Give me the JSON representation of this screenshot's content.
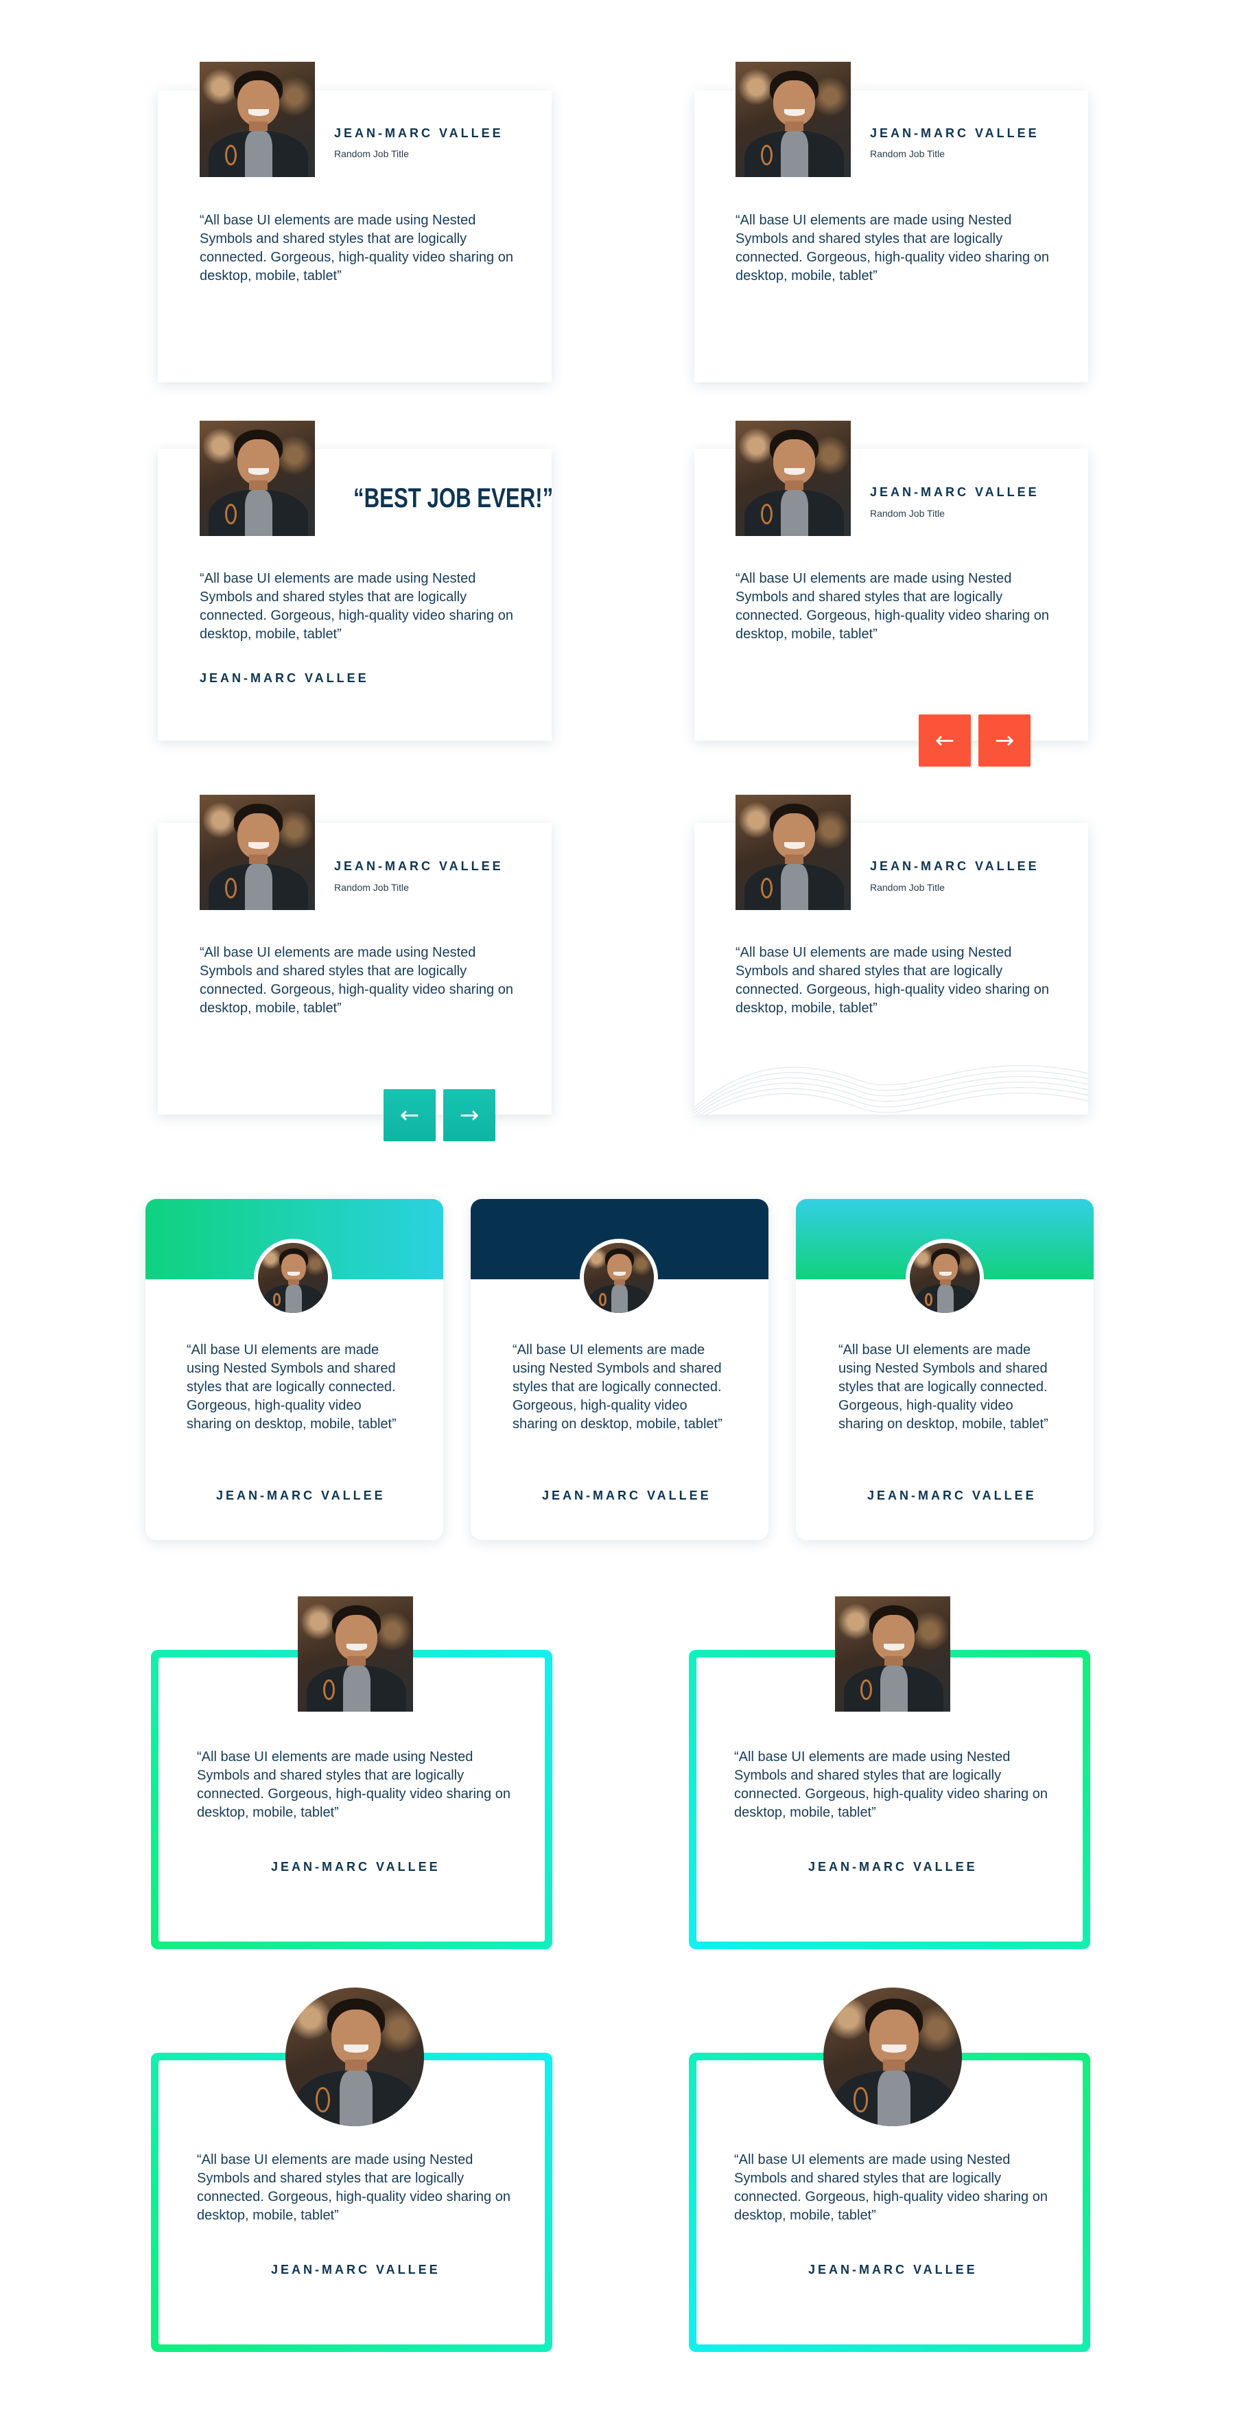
{
  "person": {
    "name": "JEAN-MARC VALLEE",
    "job_title": "Random Job Title",
    "quote": "“All base UI elements are made using Nested Symbols and shared styles that are logically connected. Gorgeous, high-quality video sharing on desktop, mobile, tablet”"
  },
  "headline": "“BEST JOB EVER!”",
  "arrows": {
    "prev": "←",
    "next": "→"
  },
  "colors": {
    "navy": "#0e3450",
    "red_arrow": "#fb5438",
    "teal_arrow": "#17c3b2",
    "green": "#12e07a",
    "cyan": "#12f0f0"
  },
  "icons": [
    "arrow-left-icon",
    "arrow-right-icon",
    "avatar-photo"
  ]
}
